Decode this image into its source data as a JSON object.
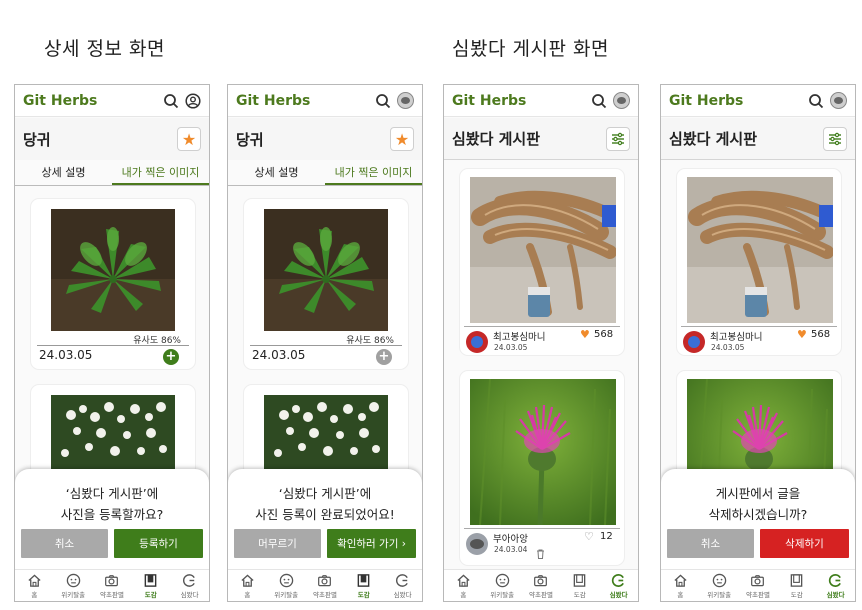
{
  "sections": {
    "detail": "상세 정보 화면",
    "board": "심봤다 게시판 화면"
  },
  "app": {
    "brand": "Git Herbs"
  },
  "detail": {
    "title": "당귀",
    "tabs": [
      "상세 설명",
      "내가 찍은 이미지"
    ],
    "similarity": "유사도 86%",
    "date": "24.03.05",
    "plus": "+"
  },
  "screen1": {
    "sheet_line1": "‘심봤다 게시판’에",
    "sheet_line2": "사진을 등록할까요?",
    "cancel": "취소",
    "confirm": "등록하기"
  },
  "screen2": {
    "sheet_line1": "‘심봤다 게시판’에",
    "sheet_line2": "사진 등록이 완료되었어요!",
    "stay": "머무르기",
    "go": "확인하러 가기 ›"
  },
  "board": {
    "title": "심봤다 게시판",
    "post1": {
      "author": "최고봉심마니",
      "date": "24.03.05",
      "likes": "568"
    },
    "post2": {
      "author": "부아아앙",
      "date": "24.03.04",
      "likes": "12"
    }
  },
  "screen4": {
    "sheet_line1": "게시판에서 글을",
    "sheet_line2": "삭제하시겠습니까?",
    "cancel": "취소",
    "delete": "삭제하기"
  },
  "nav": [
    "홈",
    "위키탈출",
    "약초판별",
    "도감",
    "심봤다"
  ],
  "colors": {
    "brand": "#4d7a1e",
    "accent": "#f08b2c",
    "delete": "#d62222"
  }
}
